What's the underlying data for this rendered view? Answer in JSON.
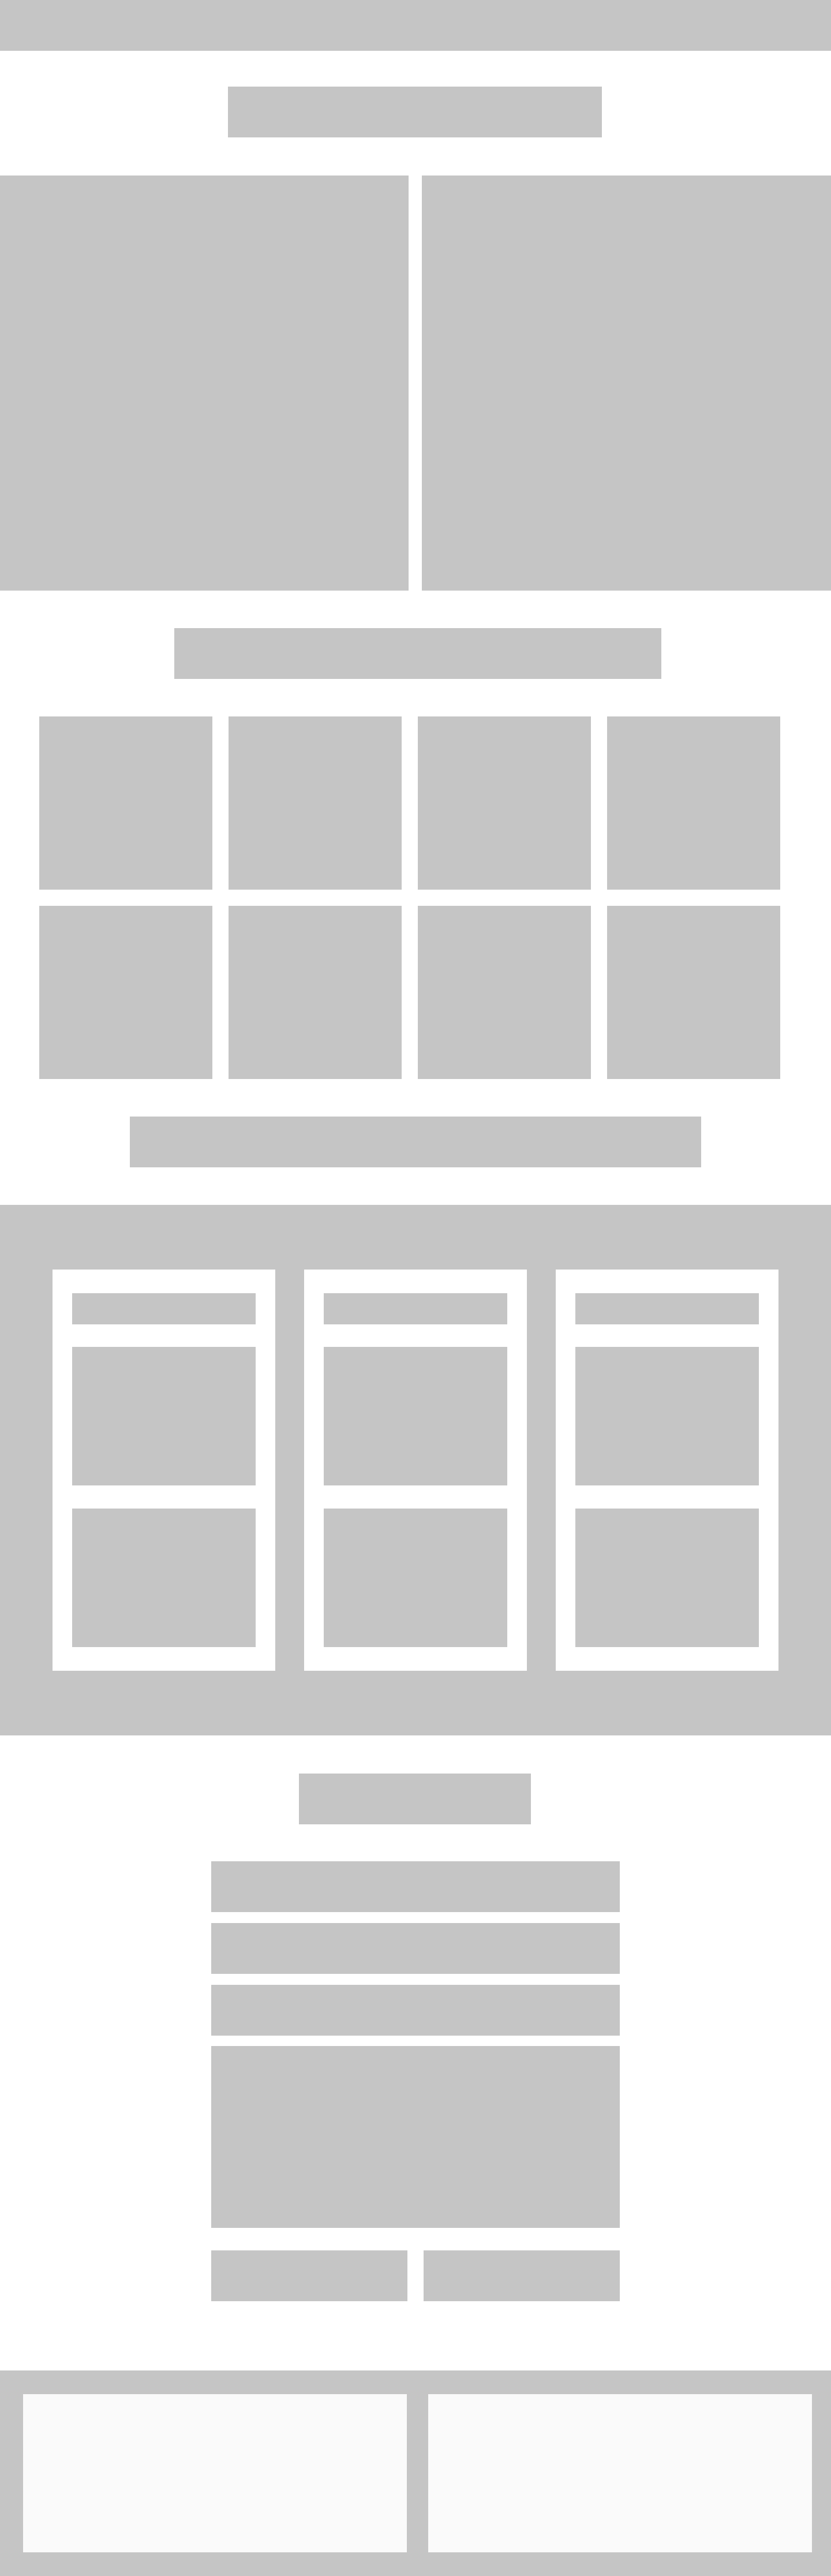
{
  "colors": {
    "placeholder": "#c5c5c5",
    "page_background": "#ffffff",
    "footer_panel": "#fafafa"
  },
  "sections": {
    "header": "placeholder",
    "hero": "placeholder",
    "grid": "placeholder",
    "feature_band": "placeholder",
    "form": "placeholder",
    "footer": "placeholder"
  }
}
